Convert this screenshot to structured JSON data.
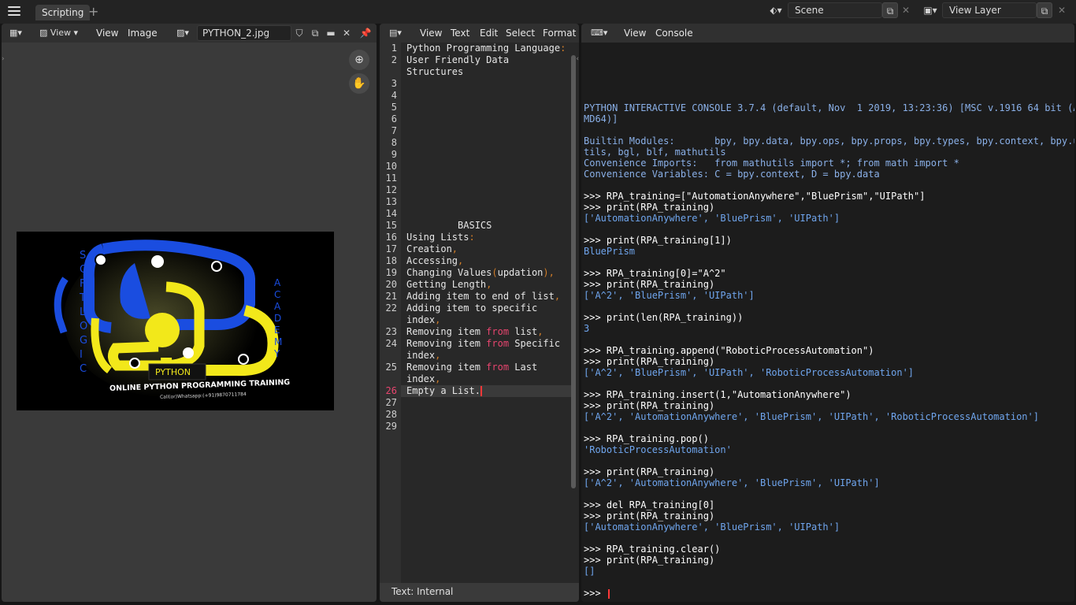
{
  "topbar": {
    "workspace_tab": "Scripting",
    "add_tab": "+",
    "scene_label": "Scene",
    "view_layer_label": "View Layer"
  },
  "image_editor": {
    "menu": [
      "View",
      "View",
      "Image"
    ],
    "image_name": "PYTHON_2.jpg",
    "picture": {
      "left_vertical": "SOFTLOGIC",
      "right_vertical": "ACADEMY",
      "banner": "PYTHON",
      "title": "ONLINE PYTHON PROGRAMMING TRAINING",
      "contact": "Call(or)Whatsapp:(+91)9870711784"
    }
  },
  "text_editor": {
    "menu": [
      "View",
      "Text",
      "Edit",
      "Select",
      "Format"
    ],
    "footer": "Text: Internal",
    "current_line": 26,
    "lines": [
      {
        "n": "1",
        "segs": [
          [
            "t",
            "Python Programming Language"
          ],
          [
            "p",
            ":"
          ]
        ]
      },
      {
        "n": "2",
        "segs": [
          [
            "t",
            "User Friendly Data"
          ]
        ]
      },
      {
        "n": "",
        "segs": [
          [
            "t",
            "Structures"
          ]
        ]
      },
      {
        "n": "3",
        "segs": []
      },
      {
        "n": "4",
        "segs": []
      },
      {
        "n": "5",
        "segs": []
      },
      {
        "n": "6",
        "segs": []
      },
      {
        "n": "7",
        "segs": []
      },
      {
        "n": "8",
        "segs": []
      },
      {
        "n": "9",
        "segs": []
      },
      {
        "n": "10",
        "segs": []
      },
      {
        "n": "11",
        "segs": []
      },
      {
        "n": "12",
        "segs": []
      },
      {
        "n": "13",
        "segs": []
      },
      {
        "n": "14",
        "segs": []
      },
      {
        "n": "15",
        "segs": [
          [
            "t",
            "         BASICS"
          ]
        ]
      },
      {
        "n": "16",
        "segs": [
          [
            "t",
            "Using Lists"
          ],
          [
            "p",
            ":"
          ]
        ]
      },
      {
        "n": "17",
        "segs": [
          [
            "t",
            "Creation"
          ],
          [
            "p",
            ","
          ]
        ]
      },
      {
        "n": "18",
        "segs": [
          [
            "t",
            "Accessing"
          ],
          [
            "p",
            ","
          ]
        ]
      },
      {
        "n": "19",
        "segs": [
          [
            "t",
            "Changing Values"
          ],
          [
            "p",
            "("
          ],
          [
            "t",
            "updation"
          ],
          [
            "p",
            "),"
          ]
        ]
      },
      {
        "n": "20",
        "segs": [
          [
            "t",
            "Getting Length"
          ],
          [
            "p",
            ","
          ]
        ]
      },
      {
        "n": "21",
        "segs": [
          [
            "t",
            "Adding item to end of list"
          ],
          [
            "p",
            ","
          ]
        ]
      },
      {
        "n": "22",
        "segs": [
          [
            "t",
            "Adding item to specific"
          ]
        ]
      },
      {
        "n": "",
        "segs": [
          [
            "t",
            "index"
          ],
          [
            "p",
            ","
          ]
        ]
      },
      {
        "n": "23",
        "segs": [
          [
            "t",
            "Removing item "
          ],
          [
            "k",
            "from"
          ],
          [
            "t",
            " list"
          ],
          [
            "p",
            ","
          ]
        ]
      },
      {
        "n": "24",
        "segs": [
          [
            "t",
            "Removing item "
          ],
          [
            "k",
            "from"
          ],
          [
            "t",
            " Specific"
          ]
        ]
      },
      {
        "n": "",
        "segs": [
          [
            "t",
            "index"
          ],
          [
            "p",
            ","
          ]
        ]
      },
      {
        "n": "25",
        "segs": [
          [
            "t",
            "Removing item "
          ],
          [
            "k",
            "from"
          ],
          [
            "t",
            " Last"
          ]
        ]
      },
      {
        "n": "",
        "segs": [
          [
            "t",
            "index"
          ],
          [
            "p",
            ","
          ]
        ]
      },
      {
        "n": "26",
        "segs": [
          [
            "t",
            "Empty a List."
          ]
        ]
      },
      {
        "n": "27",
        "segs": []
      },
      {
        "n": "28",
        "segs": []
      },
      {
        "n": "29",
        "segs": []
      }
    ]
  },
  "console": {
    "menu": [
      "View",
      "Console"
    ],
    "prompt": ">>> ",
    "lines": [
      {
        "t": "info",
        "v": "PYTHON INTERACTIVE CONSOLE 3.7.4 (default, Nov  1 2019, 13:23:36) [MSC v.1916 64 bit (A"
      },
      {
        "t": "info",
        "v": "MD64)]"
      },
      {
        "t": "blank",
        "v": ""
      },
      {
        "t": "info",
        "v": "Builtin Modules:       bpy, bpy.data, bpy.ops, bpy.props, bpy.types, bpy.context, bpy.u"
      },
      {
        "t": "info",
        "v": "tils, bgl, blf, mathutils"
      },
      {
        "t": "info",
        "v": "Convenience Imports:   from mathutils import *; from math import *"
      },
      {
        "t": "info",
        "v": "Convenience Variables: C = bpy.context, D = bpy.data"
      },
      {
        "t": "blank",
        "v": ""
      },
      {
        "t": "inp",
        "v": ">>> RPA_training=[\"AutomationAnywhere\",\"BluePrism\",\"UIPath\"]"
      },
      {
        "t": "inp",
        "v": ">>> print(RPA_training)"
      },
      {
        "t": "out",
        "v": "['AutomationAnywhere', 'BluePrism', 'UIPath']"
      },
      {
        "t": "blank",
        "v": ""
      },
      {
        "t": "inp",
        "v": ">>> print(RPA_training[1])"
      },
      {
        "t": "out",
        "v": "BluePrism"
      },
      {
        "t": "blank",
        "v": ""
      },
      {
        "t": "inp",
        "v": ">>> RPA_training[0]=\"A^2\""
      },
      {
        "t": "inp",
        "v": ">>> print(RPA_training)"
      },
      {
        "t": "out",
        "v": "['A^2', 'BluePrism', 'UIPath']"
      },
      {
        "t": "blank",
        "v": ""
      },
      {
        "t": "inp",
        "v": ">>> print(len(RPA_training))"
      },
      {
        "t": "out",
        "v": "3"
      },
      {
        "t": "blank",
        "v": ""
      },
      {
        "t": "inp",
        "v": ">>> RPA_training.append(\"RoboticProcessAutomation\")"
      },
      {
        "t": "inp",
        "v": ">>> print(RPA_training)"
      },
      {
        "t": "out",
        "v": "['A^2', 'BluePrism', 'UIPath', 'RoboticProcessAutomation']"
      },
      {
        "t": "blank",
        "v": ""
      },
      {
        "t": "inp",
        "v": ">>> RPA_training.insert(1,\"AutomationAnywhere\")"
      },
      {
        "t": "inp",
        "v": ">>> print(RPA_training)"
      },
      {
        "t": "out",
        "v": "['A^2', 'AutomationAnywhere', 'BluePrism', 'UIPath', 'RoboticProcessAutomation']"
      },
      {
        "t": "blank",
        "v": ""
      },
      {
        "t": "inp",
        "v": ">>> RPA_training.pop()"
      },
      {
        "t": "out",
        "v": "'RoboticProcessAutomation'"
      },
      {
        "t": "blank",
        "v": ""
      },
      {
        "t": "inp",
        "v": ">>> print(RPA_training)"
      },
      {
        "t": "out",
        "v": "['A^2', 'AutomationAnywhere', 'BluePrism', 'UIPath']"
      },
      {
        "t": "blank",
        "v": ""
      },
      {
        "t": "inp",
        "v": ">>> del RPA_training[0]"
      },
      {
        "t": "inp",
        "v": ">>> print(RPA_training)"
      },
      {
        "t": "out",
        "v": "['AutomationAnywhere', 'BluePrism', 'UIPath']"
      },
      {
        "t": "blank",
        "v": ""
      },
      {
        "t": "inp",
        "v": ">>> RPA_training.clear()"
      },
      {
        "t": "inp",
        "v": ">>> print(RPA_training)"
      },
      {
        "t": "out",
        "v": "[]"
      }
    ]
  }
}
